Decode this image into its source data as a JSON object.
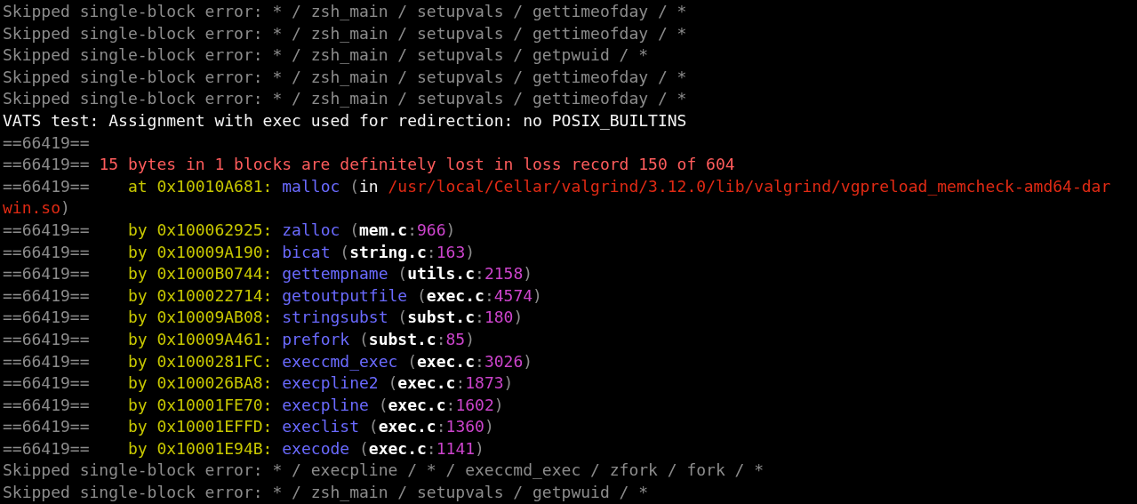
{
  "terminal": {
    "lines": [
      {
        "segments": [
          {
            "kind": "dim",
            "text": "Skipped single-block error: * / zsh_main / setupvals / gettimeofday / *"
          }
        ]
      },
      {
        "segments": [
          {
            "kind": "dim",
            "text": "Skipped single-block error: * / zsh_main / setupvals / gettimeofday / *"
          }
        ]
      },
      {
        "segments": [
          {
            "kind": "dim",
            "text": "Skipped single-block error: * / zsh_main / setupvals / getpwuid / *"
          }
        ]
      },
      {
        "segments": [
          {
            "kind": "dim",
            "text": "Skipped single-block error: * / zsh_main / setupvals / gettimeofday / *"
          }
        ]
      },
      {
        "segments": [
          {
            "kind": "dim",
            "text": "Skipped single-block error: * / zsh_main / setupvals / gettimeofday / *"
          }
        ]
      },
      {
        "segments": [
          {
            "kind": "plain",
            "text": "VATS test: Assignment with exec used for redirection: no POSIX_BUILTINS"
          }
        ]
      },
      {
        "segments": [
          {
            "kind": "dim",
            "text": "==66419=="
          }
        ]
      },
      {
        "segments": [
          {
            "kind": "dim",
            "text": "==66419== "
          },
          {
            "kind": "error",
            "text": "15 bytes in 1 blocks are definitely lost in loss record 150 of 604"
          }
        ]
      },
      {
        "segments": [
          {
            "kind": "dim",
            "text": "==66419==    "
          },
          {
            "kind": "address",
            "text": "at 0x10010A681: "
          },
          {
            "kind": "function",
            "text": "malloc"
          },
          {
            "kind": "dim",
            "text": " ("
          },
          {
            "kind": "plain",
            "text": "in "
          },
          {
            "kind": "path",
            "text": "/usr/local/Cellar/valgrind/3.12.0/lib/valgrind/vgpreload_memcheck-amd64-dar"
          }
        ]
      },
      {
        "segments": [
          {
            "kind": "path",
            "text": "win.so"
          },
          {
            "kind": "dim",
            "text": ")"
          }
        ]
      },
      {
        "segments": [
          {
            "kind": "dim",
            "text": "==66419==    "
          },
          {
            "kind": "address",
            "text": "by 0x100062925: "
          },
          {
            "kind": "function",
            "text": "zalloc"
          },
          {
            "kind": "dim",
            "text": " ("
          },
          {
            "kind": "file",
            "text": "mem.c"
          },
          {
            "kind": "dim",
            "text": ":"
          },
          {
            "kind": "lineno",
            "text": "966"
          },
          {
            "kind": "dim",
            "text": ")"
          }
        ]
      },
      {
        "segments": [
          {
            "kind": "dim",
            "text": "==66419==    "
          },
          {
            "kind": "address",
            "text": "by 0x10009A190: "
          },
          {
            "kind": "function",
            "text": "bicat"
          },
          {
            "kind": "dim",
            "text": " ("
          },
          {
            "kind": "file",
            "text": "string.c"
          },
          {
            "kind": "dim",
            "text": ":"
          },
          {
            "kind": "lineno",
            "text": "163"
          },
          {
            "kind": "dim",
            "text": ")"
          }
        ]
      },
      {
        "segments": [
          {
            "kind": "dim",
            "text": "==66419==    "
          },
          {
            "kind": "address",
            "text": "by 0x1000B0744: "
          },
          {
            "kind": "function",
            "text": "gettempname"
          },
          {
            "kind": "dim",
            "text": " ("
          },
          {
            "kind": "file",
            "text": "utils.c"
          },
          {
            "kind": "dim",
            "text": ":"
          },
          {
            "kind": "lineno",
            "text": "2158"
          },
          {
            "kind": "dim",
            "text": ")"
          }
        ]
      },
      {
        "segments": [
          {
            "kind": "dim",
            "text": "==66419==    "
          },
          {
            "kind": "address",
            "text": "by 0x100022714: "
          },
          {
            "kind": "function",
            "text": "getoutputfile"
          },
          {
            "kind": "dim",
            "text": " ("
          },
          {
            "kind": "file",
            "text": "exec.c"
          },
          {
            "kind": "dim",
            "text": ":"
          },
          {
            "kind": "lineno",
            "text": "4574"
          },
          {
            "kind": "dim",
            "text": ")"
          }
        ]
      },
      {
        "segments": [
          {
            "kind": "dim",
            "text": "==66419==    "
          },
          {
            "kind": "address",
            "text": "by 0x10009AB08: "
          },
          {
            "kind": "function",
            "text": "stringsubst"
          },
          {
            "kind": "dim",
            "text": " ("
          },
          {
            "kind": "file",
            "text": "subst.c"
          },
          {
            "kind": "dim",
            "text": ":"
          },
          {
            "kind": "lineno",
            "text": "180"
          },
          {
            "kind": "dim",
            "text": ")"
          }
        ]
      },
      {
        "segments": [
          {
            "kind": "dim",
            "text": "==66419==    "
          },
          {
            "kind": "address",
            "text": "by 0x10009A461: "
          },
          {
            "kind": "function",
            "text": "prefork"
          },
          {
            "kind": "dim",
            "text": " ("
          },
          {
            "kind": "file",
            "text": "subst.c"
          },
          {
            "kind": "dim",
            "text": ":"
          },
          {
            "kind": "lineno",
            "text": "85"
          },
          {
            "kind": "dim",
            "text": ")"
          }
        ]
      },
      {
        "segments": [
          {
            "kind": "dim",
            "text": "==66419==    "
          },
          {
            "kind": "address",
            "text": "by 0x1000281FC: "
          },
          {
            "kind": "function",
            "text": "execcmd_exec"
          },
          {
            "kind": "dim",
            "text": " ("
          },
          {
            "kind": "file",
            "text": "exec.c"
          },
          {
            "kind": "dim",
            "text": ":"
          },
          {
            "kind": "lineno",
            "text": "3026"
          },
          {
            "kind": "dim",
            "text": ")"
          }
        ]
      },
      {
        "segments": [
          {
            "kind": "dim",
            "text": "==66419==    "
          },
          {
            "kind": "address",
            "text": "by 0x100026BA8: "
          },
          {
            "kind": "function",
            "text": "execpline2"
          },
          {
            "kind": "dim",
            "text": " ("
          },
          {
            "kind": "file",
            "text": "exec.c"
          },
          {
            "kind": "dim",
            "text": ":"
          },
          {
            "kind": "lineno",
            "text": "1873"
          },
          {
            "kind": "dim",
            "text": ")"
          }
        ]
      },
      {
        "segments": [
          {
            "kind": "dim",
            "text": "==66419==    "
          },
          {
            "kind": "address",
            "text": "by 0x10001FE70: "
          },
          {
            "kind": "function",
            "text": "execpline"
          },
          {
            "kind": "dim",
            "text": " ("
          },
          {
            "kind": "file",
            "text": "exec.c"
          },
          {
            "kind": "dim",
            "text": ":"
          },
          {
            "kind": "lineno",
            "text": "1602"
          },
          {
            "kind": "dim",
            "text": ")"
          }
        ]
      },
      {
        "segments": [
          {
            "kind": "dim",
            "text": "==66419==    "
          },
          {
            "kind": "address",
            "text": "by 0x10001EFFD: "
          },
          {
            "kind": "function",
            "text": "execlist"
          },
          {
            "kind": "dim",
            "text": " ("
          },
          {
            "kind": "file",
            "text": "exec.c"
          },
          {
            "kind": "dim",
            "text": ":"
          },
          {
            "kind": "lineno",
            "text": "1360"
          },
          {
            "kind": "dim",
            "text": ")"
          }
        ]
      },
      {
        "segments": [
          {
            "kind": "dim",
            "text": "==66419==    "
          },
          {
            "kind": "address",
            "text": "by 0x10001E94B: "
          },
          {
            "kind": "function",
            "text": "execode"
          },
          {
            "kind": "dim",
            "text": " ("
          },
          {
            "kind": "file",
            "text": "exec.c"
          },
          {
            "kind": "dim",
            "text": ":"
          },
          {
            "kind": "lineno",
            "text": "1141"
          },
          {
            "kind": "dim",
            "text": ")"
          }
        ]
      },
      {
        "segments": [
          {
            "kind": "dim",
            "text": "Skipped single-block error: * / execpline / * / execcmd_exec / zfork / fork / *"
          }
        ]
      },
      {
        "segments": [
          {
            "kind": "dim",
            "text": "Skipped single-block error: * / zsh_main / setupvals / getpwuid / *"
          }
        ]
      }
    ]
  }
}
